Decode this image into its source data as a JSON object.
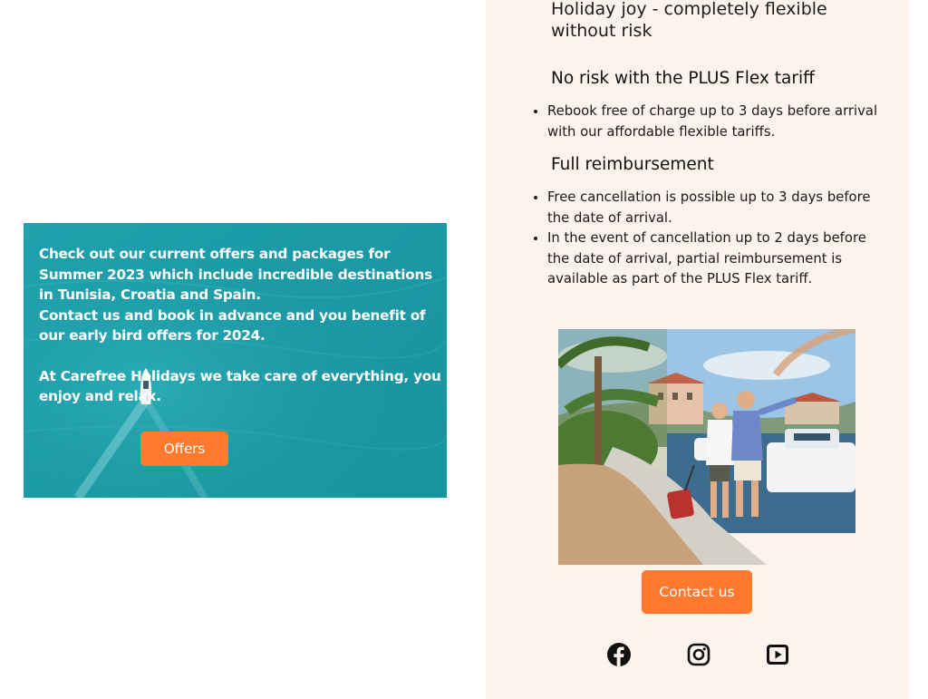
{
  "promo": {
    "paragraph1": "Check out our current offers and packages for Summer 2023 which include incredible destinations in Tunisia, Croatia and Spain.",
    "paragraph2": "Contact us and book in advance and you benefit of our early bird offers for 2024.",
    "paragraph3": "At Carefree Holidays we take care of everything, you enjoy and relax.",
    "button_label": "Offers",
    "colors": {
      "sea": "#1b9aa6",
      "button": "#ff7a2e"
    }
  },
  "info": {
    "tagline": "Holiday joy - completely flexible without risk",
    "sections": [
      {
        "heading": "No risk with the PLUS Flex tariff",
        "items": [
          "Rebook free of charge up to 3 days before arrival with our affordable flexible tariffs."
        ]
      },
      {
        "heading": "Full reimbursement",
        "items": [
          "Free cancellation is possible up to 3 days before the date of arrival.",
          "In the event of cancellation up to 2 days before the date of arrival, partial reimbursement is available as part of the PLUS Flex tariff."
        ]
      }
    ],
    "contact_label": "Contact us",
    "colors": {
      "panel": "#fdf3ec",
      "button": "#ff7a2e"
    }
  },
  "social": {
    "icons": [
      "facebook-icon",
      "instagram-icon",
      "youtube-icon"
    ]
  }
}
